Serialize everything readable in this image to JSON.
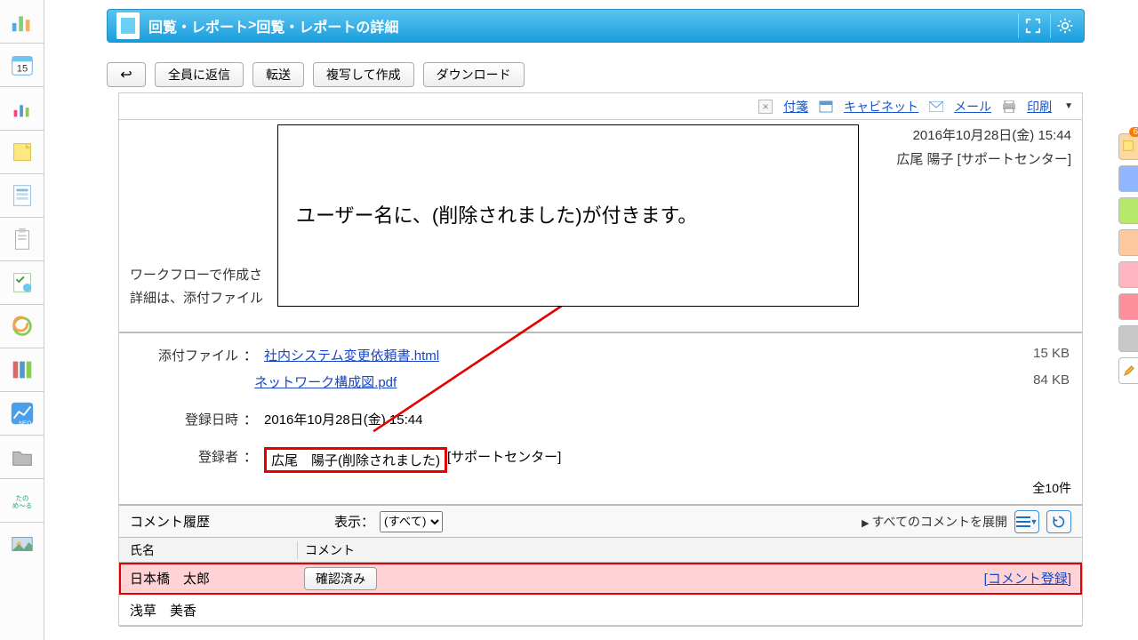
{
  "header": {
    "breadcrumb_app": "回覧・レポート",
    "breadcrumb_sep": " > ",
    "breadcrumb_page": "回覧・レポートの詳細"
  },
  "toolbar": {
    "back_glyph": "↩",
    "reply_all": "全員に返信",
    "forward": "転送",
    "copy_create": "複写して作成",
    "download": "ダウンロード"
  },
  "linkbar": {
    "close_glyph": "×",
    "sticky": "付箋",
    "cabinet": "キャビネット",
    "mail": "メール",
    "print": "印刷",
    "print_arrow": "▼"
  },
  "info": {
    "date": "2016年10月28日(金) 15:44",
    "sender": "広尾 陽子 [サポートセンター]",
    "body_line1": "ワークフローで作成さ",
    "body_line2": "詳細は、添付ファイル"
  },
  "callout": {
    "text": "ユーザー名に、(削除されました)が付きます。"
  },
  "attachments": {
    "label": "添付ファイル",
    "file1_name": "社内システム変更依頼書.html",
    "file1_size": "15 KB",
    "file2_name": "ネットワーク構成図.pdf",
    "file2_size": "84 KB"
  },
  "registered": {
    "date_label": "登録日時",
    "date_value": "2016年10月28日(金) 15:44",
    "user_label": "登録者",
    "user_value": "広尾　陽子(削除されました)",
    "user_dept": " [サポートセンター]"
  },
  "count": {
    "text": "全10件"
  },
  "comments": {
    "history_title": "コメント履歴",
    "display_label": "表示：",
    "display_option": "(すべて)",
    "expand_all": "すべてのコメントを展開",
    "col_name": "氏名",
    "col_comment": "コメント",
    "row1_name": "日本橋　太郎",
    "row1_action": "確認済み",
    "row1_register": "[コメント登録]",
    "row2_name": "浅草　美香"
  },
  "right_tabs": {
    "badge": "6"
  }
}
